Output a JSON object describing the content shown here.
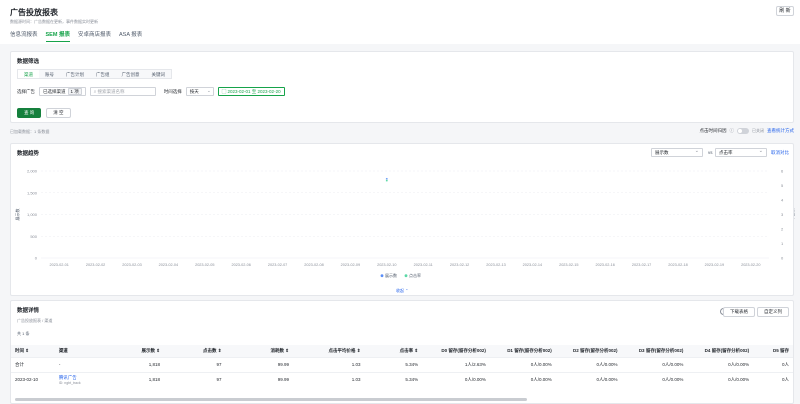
{
  "header": {
    "title": "广告投放报表",
    "subtitle": "数据源时间：广告数据在更新，事件数据实时更新",
    "refresh_label": "刷 新"
  },
  "tabs": [
    {
      "label": "信息流报表",
      "active": false
    },
    {
      "label": "SEM 报表",
      "active": true
    },
    {
      "label": "安卓商店报表",
      "active": false
    },
    {
      "label": "ASA 报表",
      "active": false
    }
  ],
  "filter": {
    "title": "数据筛选",
    "tabs": [
      "渠道",
      "账号",
      "广告计划",
      "广告组",
      "广告创意",
      "关键词"
    ],
    "select_label": "选择广告",
    "selected_text": "已选择渠道",
    "selected_count": "1 项",
    "search_placeholder": "搜索渠道名称",
    "time_label": "时间选择",
    "time_unit": "按天",
    "date_range": "2023-02-01 至 2023-02-20",
    "query_label": "查 询",
    "reset_label": "清 空"
  },
  "filter_summary": "已加载数据：1 条数据",
  "toggle_bar": {
    "label": "点击时间归因",
    "toggle_state": "已关闭",
    "link_label": "查看统计方式"
  },
  "trend": {
    "title": "数据趋势",
    "metric_left": "展示数",
    "vs_label": "vs",
    "metric_right": "点击率",
    "cancel_compare": "取消对比",
    "collapse_label": "收起 ⌃"
  },
  "chart_data": {
    "type": "line",
    "x": [
      "2023-02-01",
      "2023-02-02",
      "2023-02-03",
      "2023-02-04",
      "2023-02-05",
      "2023-02-06",
      "2023-02-07",
      "2023-02-08",
      "2023-02-09",
      "2023-02-10",
      "2023-02-11",
      "2023-02-12",
      "2023-02-13",
      "2023-02-14",
      "2023-02-15",
      "2023-02-16",
      "2023-02-17",
      "2023-02-18",
      "2023-02-19",
      "2023-02-20"
    ],
    "series": [
      {
        "name": "展示数",
        "axis": "left",
        "color": "#5b8ff9",
        "values": [
          null,
          null,
          null,
          null,
          null,
          null,
          null,
          null,
          null,
          1818,
          null,
          null,
          null,
          null,
          null,
          null,
          null,
          null,
          null,
          null
        ]
      },
      {
        "name": "点击率",
        "axis": "right",
        "color": "#5ad8a6",
        "values": [
          null,
          null,
          null,
          null,
          null,
          null,
          null,
          null,
          null,
          5.34,
          null,
          null,
          null,
          null,
          null,
          null,
          null,
          null,
          null,
          null
        ]
      }
    ],
    "y_left_ticks": [
      "0",
      "500",
      "1,000",
      "1,500",
      "2,000"
    ],
    "y_left_range": [
      0,
      2000
    ],
    "y_right_ticks": [
      "0",
      "1",
      "2",
      "3",
      "4",
      "5",
      "6"
    ],
    "y_right_range": [
      0,
      6
    ],
    "ylabel_left": "展示数",
    "ylabel_right": "点击率",
    "grid": true,
    "legend": "bottom-center"
  },
  "detail": {
    "title": "数据详情",
    "subtitle": "广告投放报表 / 渠道",
    "count": "共 1 条",
    "download_label": "下载表格",
    "custom_col_label": "自定义列",
    "help_icon": "?",
    "columns": [
      "时间 ⇕",
      "渠道",
      "展示数 ⇕",
      "点击数 ⇕",
      "消耗数 ⇕",
      "点击平均价格 ⇕",
      "点击率 ⇕",
      "D0 留存(留存分析002)",
      "D1 留存(留存分析002)",
      "D2 留存(留存分析002)",
      "D3 留存(留存分析002)",
      "D4 留存(留存分析002)",
      "D5 留存"
    ],
    "rows": [
      [
        "合计",
        "-",
        "1,818",
        "97",
        "99.99",
        "1.03",
        "5.34%",
        "1人/2.63%",
        "0人/0.00%",
        "0人/0.00%",
        "0人/0.00%",
        "0人/0.00%",
        "0人"
      ],
      [
        "2023-02-10",
        "腾讯广告",
        "1,818",
        "97",
        "99.99",
        "1.03",
        "5.34%",
        "0人/0.00%",
        "0人/0.00%",
        "0人/0.00%",
        "0人/0.00%",
        "0人/0.00%",
        "0人"
      ]
    ],
    "row2_id": "ID: ngbt_track"
  }
}
